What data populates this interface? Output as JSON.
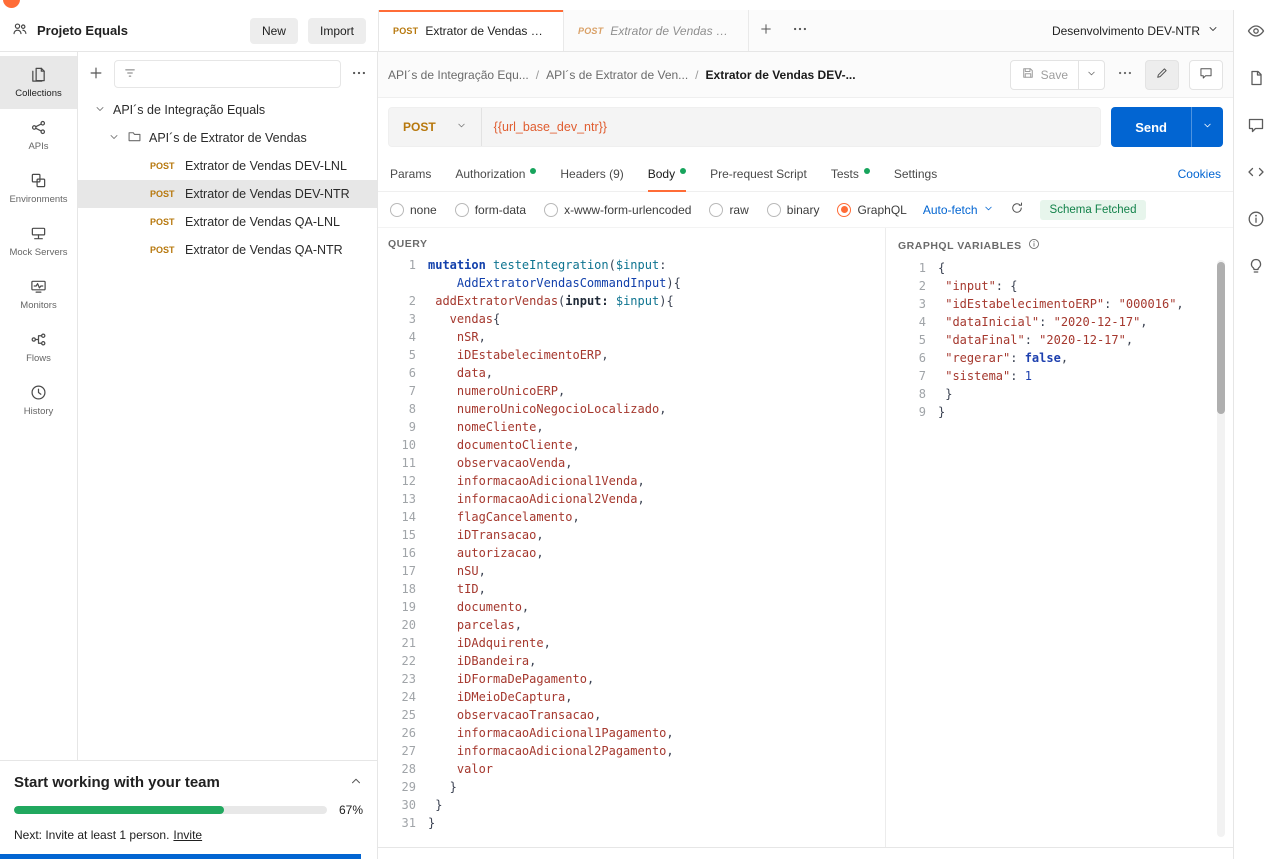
{
  "colors": {
    "brand": "#FF6C37",
    "blue": "#0265D2",
    "green": "#17A45C",
    "post": "#B7780D",
    "urlvar": "#E05D30",
    "progress": "#21A85F"
  },
  "topbar": {
    "workspace": "Projeto Equals",
    "new_label": "New",
    "import_label": "Import",
    "tabs": [
      {
        "method": "POST",
        "title": "Extrator de Vendas DEV",
        "state": "active"
      },
      {
        "method": "POST",
        "title": "Extrator de Vendas DEV",
        "state": "preview"
      }
    ],
    "environment": "Desenvolvimento DEV-NTR"
  },
  "left_rail": {
    "items": [
      {
        "label": "Collections",
        "icon": "collections-icon",
        "active": true
      },
      {
        "label": "APIs",
        "icon": "apis-icon",
        "active": false
      },
      {
        "label": "Environments",
        "icon": "environments-icon",
        "active": false
      },
      {
        "label": "Mock Servers",
        "icon": "mock-servers-icon",
        "active": false
      },
      {
        "label": "Monitors",
        "icon": "monitors-icon",
        "active": false
      },
      {
        "label": "Flows",
        "icon": "flows-icon",
        "active": false
      },
      {
        "label": "History",
        "icon": "history-icon",
        "active": false
      }
    ]
  },
  "sidebar": {
    "root_item": "API´s de Integração Equals",
    "folder_item": "API´s de Extrator de Vendas",
    "requests": [
      {
        "method": "POST",
        "name": "Extrator de Vendas DEV-LNL",
        "selected": false
      },
      {
        "method": "POST",
        "name": "Extrator de Vendas DEV-NTR",
        "selected": true
      },
      {
        "method": "POST",
        "name": "Extrator de Vendas QA-LNL",
        "selected": false
      },
      {
        "method": "POST",
        "name": "Extrator de Vendas QA-NTR",
        "selected": false
      }
    ]
  },
  "team_banner": {
    "title": "Start working with your team",
    "progress_percent": 67,
    "progress_label": "67%",
    "next_text": "Next: Invite at least 1 person.",
    "invite_link": "Invite"
  },
  "request": {
    "breadcrumb": [
      "API´s de Integração Equ...",
      "API´s de Extrator de Ven...",
      "Extrator de Vendas DEV-..."
    ],
    "save_label": "Save",
    "method": "POST",
    "url": "{{url_base_dev_ntr}}",
    "send_label": "Send",
    "tabs": [
      {
        "label": "Params",
        "dot": false,
        "active": false
      },
      {
        "label": "Authorization",
        "dot": true,
        "active": false
      },
      {
        "label": "Headers (9)",
        "dot": false,
        "active": false
      },
      {
        "label": "Body",
        "dot": true,
        "active": true
      },
      {
        "label": "Pre-request Script",
        "dot": false,
        "active": false
      },
      {
        "label": "Tests",
        "dot": true,
        "active": false
      },
      {
        "label": "Settings",
        "dot": false,
        "active": false
      }
    ],
    "cookies_label": "Cookies",
    "body_modes": [
      {
        "label": "none",
        "selected": false
      },
      {
        "label": "form-data",
        "selected": false
      },
      {
        "label": "x-www-form-urlencoded",
        "selected": false
      },
      {
        "label": "raw",
        "selected": false
      },
      {
        "label": "binary",
        "selected": false
      },
      {
        "label": "GraphQL",
        "selected": true
      }
    ],
    "autofetch_label": "Auto-fetch",
    "schema_status": "Schema Fetched"
  },
  "query_editor": {
    "label": "QUERY",
    "lines": [
      {
        "n": "1",
        "i": 0,
        "s": [
          [
            "mutation ",
            "kw"
          ],
          [
            "testeIntegration",
            "op"
          ],
          [
            "(",
            "pl"
          ],
          [
            "$input",
            "var"
          ],
          [
            ":",
            "pl"
          ]
        ]
      },
      {
        "n": "",
        "i": 4,
        "s": [
          [
            "AddExtratorVendasCommandInput",
            "typ"
          ],
          [
            "){",
            "pl"
          ]
        ]
      },
      {
        "n": "2",
        "i": 1,
        "s": [
          [
            "addExtratorVendas",
            "fld"
          ],
          [
            "(",
            "pl"
          ],
          [
            "input: ",
            "arg"
          ],
          [
            "$input",
            "var"
          ],
          [
            "){",
            "pl"
          ]
        ]
      },
      {
        "n": "3",
        "i": 3,
        "s": [
          [
            "vendas",
            "fld"
          ],
          [
            "{",
            "pl"
          ]
        ]
      },
      {
        "n": "4",
        "i": 4,
        "s": [
          [
            "nSR",
            "fld"
          ],
          [
            ",",
            "pl"
          ]
        ]
      },
      {
        "n": "5",
        "i": 4,
        "s": [
          [
            "iDEstabelecimentoERP",
            "fld"
          ],
          [
            ",",
            "pl"
          ]
        ]
      },
      {
        "n": "6",
        "i": 4,
        "s": [
          [
            "data",
            "fld"
          ],
          [
            ",",
            "pl"
          ]
        ]
      },
      {
        "n": "7",
        "i": 4,
        "s": [
          [
            "numeroUnicoERP",
            "fld"
          ],
          [
            ",",
            "pl"
          ]
        ]
      },
      {
        "n": "8",
        "i": 4,
        "s": [
          [
            "numeroUnicoNegocioLocalizado",
            "fld"
          ],
          [
            ",",
            "pl"
          ]
        ]
      },
      {
        "n": "9",
        "i": 4,
        "s": [
          [
            "nomeCliente",
            "fld"
          ],
          [
            ",",
            "pl"
          ]
        ]
      },
      {
        "n": "10",
        "i": 4,
        "s": [
          [
            "documentoCliente",
            "fld"
          ],
          [
            ",",
            "pl"
          ]
        ]
      },
      {
        "n": "11",
        "i": 4,
        "s": [
          [
            "observacaoVenda",
            "fld"
          ],
          [
            ",",
            "pl"
          ]
        ]
      },
      {
        "n": "12",
        "i": 4,
        "s": [
          [
            "informacaoAdicional1Venda",
            "fld"
          ],
          [
            ",",
            "pl"
          ]
        ]
      },
      {
        "n": "13",
        "i": 4,
        "s": [
          [
            "informacaoAdicional2Venda",
            "fld"
          ],
          [
            ",",
            "pl"
          ]
        ]
      },
      {
        "n": "14",
        "i": 4,
        "s": [
          [
            "flagCancelamento",
            "fld"
          ],
          [
            ",",
            "pl"
          ]
        ]
      },
      {
        "n": "15",
        "i": 4,
        "s": [
          [
            "iDTransacao",
            "fld"
          ],
          [
            ",",
            "pl"
          ]
        ]
      },
      {
        "n": "16",
        "i": 4,
        "s": [
          [
            "autorizacao",
            "fld"
          ],
          [
            ",",
            "pl"
          ]
        ]
      },
      {
        "n": "17",
        "i": 4,
        "s": [
          [
            "nSU",
            "fld"
          ],
          [
            ",",
            "pl"
          ]
        ]
      },
      {
        "n": "18",
        "i": 4,
        "s": [
          [
            "tID",
            "fld"
          ],
          [
            ",",
            "pl"
          ]
        ]
      },
      {
        "n": "19",
        "i": 4,
        "s": [
          [
            "documento",
            "fld"
          ],
          [
            ",",
            "pl"
          ]
        ]
      },
      {
        "n": "20",
        "i": 4,
        "s": [
          [
            "parcelas",
            "fld"
          ],
          [
            ",",
            "pl"
          ]
        ]
      },
      {
        "n": "21",
        "i": 4,
        "s": [
          [
            "iDAdquirente",
            "fld"
          ],
          [
            ",",
            "pl"
          ]
        ]
      },
      {
        "n": "22",
        "i": 4,
        "s": [
          [
            "iDBandeira",
            "fld"
          ],
          [
            ",",
            "pl"
          ]
        ]
      },
      {
        "n": "23",
        "i": 4,
        "s": [
          [
            "iDFormaDePagamento",
            "fld"
          ],
          [
            ",",
            "pl"
          ]
        ]
      },
      {
        "n": "24",
        "i": 4,
        "s": [
          [
            "iDMeioDeCaptura",
            "fld"
          ],
          [
            ",",
            "pl"
          ]
        ]
      },
      {
        "n": "25",
        "i": 4,
        "s": [
          [
            "observacaoTransacao",
            "fld"
          ],
          [
            ",",
            "pl"
          ]
        ]
      },
      {
        "n": "26",
        "i": 4,
        "s": [
          [
            "informacaoAdicional1Pagamento",
            "fld"
          ],
          [
            ",",
            "pl"
          ]
        ]
      },
      {
        "n": "27",
        "i": 4,
        "s": [
          [
            "informacaoAdicional2Pagamento",
            "fld"
          ],
          [
            ",",
            "pl"
          ]
        ]
      },
      {
        "n": "28",
        "i": 4,
        "s": [
          [
            "valor",
            "fld"
          ]
        ]
      },
      {
        "n": "29",
        "i": 3,
        "s": [
          [
            "}",
            "pl"
          ]
        ]
      },
      {
        "n": "30",
        "i": 1,
        "s": [
          [
            "}",
            "pl"
          ]
        ]
      },
      {
        "n": "31",
        "i": 0,
        "s": [
          [
            "}",
            "pl"
          ]
        ]
      }
    ]
  },
  "variables_editor": {
    "label": "GRAPHQL VARIABLES",
    "lines": [
      {
        "n": "1",
        "i": 0,
        "s": [
          [
            "{",
            "pl"
          ]
        ]
      },
      {
        "n": "2",
        "i": 1,
        "s": [
          [
            "\"input\"",
            "key"
          ],
          [
            ": {",
            "pl"
          ]
        ]
      },
      {
        "n": "3",
        "i": 1,
        "s": [
          [
            "\"idEstabelecimentoERP\"",
            "key"
          ],
          [
            ": ",
            "pl"
          ],
          [
            "\"000016\"",
            "str"
          ],
          [
            ",",
            "pl"
          ]
        ]
      },
      {
        "n": "4",
        "i": 1,
        "s": [
          [
            "\"dataInicial\"",
            "key"
          ],
          [
            ": ",
            "pl"
          ],
          [
            "\"2020-12-17\"",
            "str"
          ],
          [
            ",",
            "pl"
          ]
        ]
      },
      {
        "n": "5",
        "i": 1,
        "s": [
          [
            "\"dataFinal\"",
            "key"
          ],
          [
            ": ",
            "pl"
          ],
          [
            "\"2020-12-17\"",
            "str"
          ],
          [
            ",",
            "pl"
          ]
        ]
      },
      {
        "n": "6",
        "i": 1,
        "s": [
          [
            "\"regerar\"",
            "key"
          ],
          [
            ": ",
            "pl"
          ],
          [
            "false",
            "atom"
          ],
          [
            ",",
            "pl"
          ]
        ]
      },
      {
        "n": "7",
        "i": 1,
        "s": [
          [
            "\"sistema\"",
            "key"
          ],
          [
            ": ",
            "pl"
          ],
          [
            "1",
            "num"
          ]
        ]
      },
      {
        "n": "8",
        "i": 1,
        "s": [
          [
            "}",
            "pl"
          ]
        ]
      },
      {
        "n": "9",
        "i": 0,
        "s": [
          [
            "}",
            "pl"
          ]
        ]
      }
    ]
  }
}
